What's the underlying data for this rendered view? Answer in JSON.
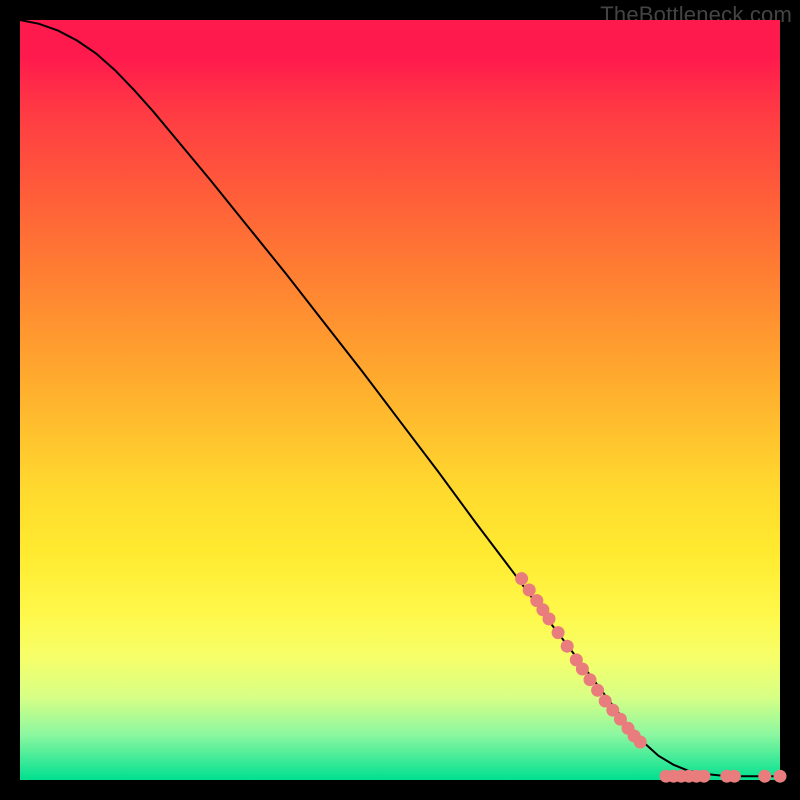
{
  "watermark": "TheBottleneck.com",
  "colors": {
    "background": "#000000",
    "gradient_top": "#ff1a4d",
    "gradient_mid": "#ffda2e",
    "gradient_bottom": "#00e090",
    "curve": "#000000",
    "points": "#e97c7c"
  },
  "chart_data": {
    "type": "line",
    "title": "",
    "xlabel": "",
    "ylabel": "",
    "xlim": [
      0,
      100
    ],
    "ylim": [
      0,
      100
    ],
    "curve": [
      {
        "x": 0.0,
        "y": 100.0
      },
      {
        "x": 2.5,
        "y": 99.5
      },
      {
        "x": 5.0,
        "y": 98.6
      },
      {
        "x": 7.5,
        "y": 97.3
      },
      {
        "x": 10.0,
        "y": 95.6
      },
      {
        "x": 12.5,
        "y": 93.4
      },
      {
        "x": 15.0,
        "y": 90.8
      },
      {
        "x": 17.5,
        "y": 88.0
      },
      {
        "x": 20.0,
        "y": 85.0
      },
      {
        "x": 25.0,
        "y": 79.0
      },
      {
        "x": 30.0,
        "y": 72.8
      },
      {
        "x": 35.0,
        "y": 66.6
      },
      {
        "x": 40.0,
        "y": 60.2
      },
      {
        "x": 45.0,
        "y": 53.8
      },
      {
        "x": 50.0,
        "y": 47.2
      },
      {
        "x": 55.0,
        "y": 40.6
      },
      {
        "x": 60.0,
        "y": 33.8
      },
      {
        "x": 65.0,
        "y": 27.2
      },
      {
        "x": 70.0,
        "y": 20.4
      },
      {
        "x": 75.0,
        "y": 13.8
      },
      {
        "x": 78.0,
        "y": 9.8
      },
      {
        "x": 80.0,
        "y": 7.2
      },
      {
        "x": 82.0,
        "y": 5.0
      },
      {
        "x": 84.0,
        "y": 3.2
      },
      {
        "x": 86.0,
        "y": 2.0
      },
      {
        "x": 88.0,
        "y": 1.2
      },
      {
        "x": 90.0,
        "y": 0.8
      },
      {
        "x": 92.0,
        "y": 0.6
      },
      {
        "x": 94.0,
        "y": 0.5
      },
      {
        "x": 96.0,
        "y": 0.5
      },
      {
        "x": 98.0,
        "y": 0.5
      },
      {
        "x": 100.0,
        "y": 0.5
      }
    ],
    "highlight_points": [
      {
        "x": 66.0,
        "y": 26.5
      },
      {
        "x": 67.0,
        "y": 25.0
      },
      {
        "x": 68.0,
        "y": 23.6
      },
      {
        "x": 68.8,
        "y": 22.4
      },
      {
        "x": 69.6,
        "y": 21.2
      },
      {
        "x": 70.8,
        "y": 19.4
      },
      {
        "x": 72.0,
        "y": 17.6
      },
      {
        "x": 73.2,
        "y": 15.8
      },
      {
        "x": 74.0,
        "y": 14.6
      },
      {
        "x": 75.0,
        "y": 13.2
      },
      {
        "x": 76.0,
        "y": 11.8
      },
      {
        "x": 77.0,
        "y": 10.4
      },
      {
        "x": 78.0,
        "y": 9.2
      },
      {
        "x": 79.0,
        "y": 8.0
      },
      {
        "x": 80.0,
        "y": 6.8
      },
      {
        "x": 80.8,
        "y": 5.8
      },
      {
        "x": 81.6,
        "y": 5.0
      },
      {
        "x": 85.0,
        "y": 0.5
      },
      {
        "x": 86.0,
        "y": 0.5
      },
      {
        "x": 87.0,
        "y": 0.5
      },
      {
        "x": 88.0,
        "y": 0.5
      },
      {
        "x": 89.0,
        "y": 0.5
      },
      {
        "x": 90.0,
        "y": 0.5
      },
      {
        "x": 93.0,
        "y": 0.5
      },
      {
        "x": 94.0,
        "y": 0.5
      },
      {
        "x": 98.0,
        "y": 0.5
      },
      {
        "x": 100.0,
        "y": 0.5
      }
    ]
  }
}
